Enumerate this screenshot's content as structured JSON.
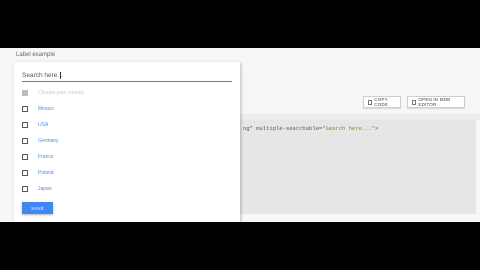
{
  "page": {
    "label_example": "Label example"
  },
  "toolbar": {
    "copy_label": "COPY CODE",
    "open_label": "OPEN IN MDB EDITOR"
  },
  "code": {
    "prefix": "ng\"",
    "attr": " multiple-searchable=",
    "value": "\"Search here...\"",
    "suffix": ">"
  },
  "dropdown": {
    "search_placeholder": "Search here...",
    "options": [
      {
        "label": "Choose your country",
        "disabled": true
      },
      {
        "label": "Mexico",
        "disabled": false
      },
      {
        "label": "USA",
        "disabled": false
      },
      {
        "label": "Germany",
        "disabled": false
      },
      {
        "label": "France",
        "disabled": false
      },
      {
        "label": "Poland",
        "disabled": false
      },
      {
        "label": "Japan",
        "disabled": false
      }
    ],
    "save_label": "SAVE"
  },
  "colors": {
    "accent": "#4285f4",
    "option_text": "#4a8fe0",
    "disabled": "#c8c8c8"
  }
}
